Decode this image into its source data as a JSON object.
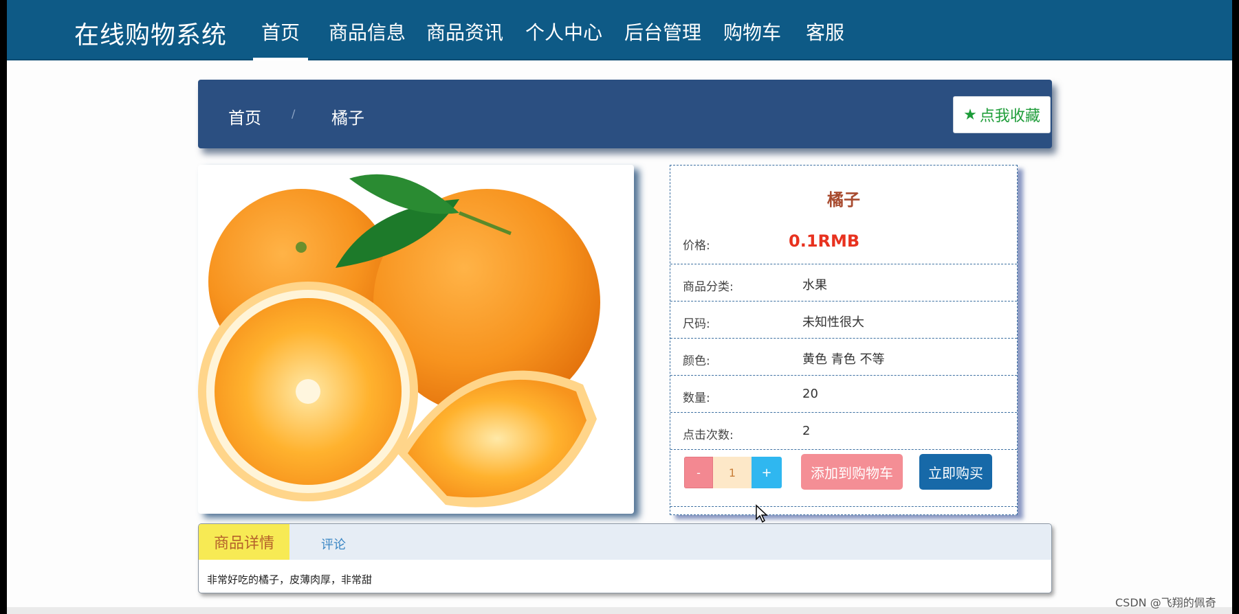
{
  "app": {
    "title": "在线购物系统"
  },
  "nav": {
    "items": [
      {
        "label": "首页",
        "active": true
      },
      {
        "label": "商品信息"
      },
      {
        "label": "商品资讯"
      },
      {
        "label": "个人中心"
      },
      {
        "label": "后台管理"
      },
      {
        "label": "购物车"
      },
      {
        "label": "客服"
      }
    ]
  },
  "breadcrumb": {
    "home": "首页",
    "separator": "/",
    "current": "橘子"
  },
  "favorite": {
    "label": "点我收藏",
    "icon": "star-icon"
  },
  "product": {
    "name": "橘子",
    "price_label": "价格:",
    "price": "0.1RMB",
    "fields": [
      {
        "label": "商品分类:",
        "value": "水果"
      },
      {
        "label": "尺码:",
        "value": "未知性很大"
      },
      {
        "label": "颜色:",
        "value": "黄色 青色 不等"
      },
      {
        "label": "数量:",
        "value": "20"
      },
      {
        "label": "点击次数:",
        "value": "2"
      }
    ],
    "stepper": {
      "minus": "-",
      "value": "1",
      "plus": "+"
    },
    "add_to_cart": "添加到购物车",
    "buy_now": "立即购买"
  },
  "tabs": {
    "items": [
      {
        "label": "商品详情",
        "active": true
      },
      {
        "label": "评论"
      }
    ],
    "content": "非常好吃的橘子，皮薄肉厚，非常甜"
  },
  "watermark": "CSDN @飞翔的佩奇",
  "colors": {
    "nav_bg": "#0e5a86",
    "crumb_bg": "#2b4f81",
    "price": "#e8321f",
    "title": "#a84b2f",
    "cart_btn": "#f48e95",
    "buy_btn": "#1769a8",
    "tab_active": "#f7ea54"
  }
}
